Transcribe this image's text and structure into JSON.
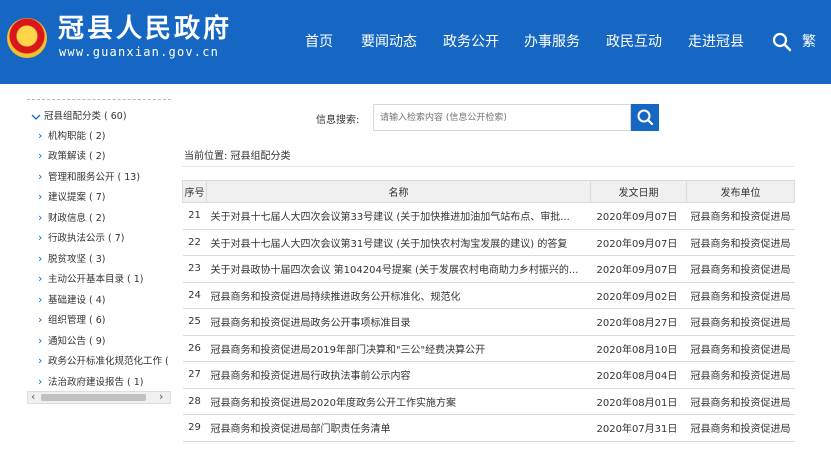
{
  "header": {
    "title": "冠县人民政府",
    "url": "www.guanxian.gov.cn",
    "nav": [
      "首页",
      "要闻动态",
      "政务公开",
      "办事服务",
      "政民互动",
      "走进冠县"
    ],
    "lang_toggle": "繁",
    "search_icon": "search-icon",
    "emblem_icon": "national-emblem-icon",
    "color": "#1567c3"
  },
  "sidebar": {
    "root": "冠县组配分类 ( 60)",
    "items": [
      "机构职能 ( 2)",
      "政策解读 ( 2)",
      "管理和服务公开 ( 13)",
      "建议提案 ( 7)",
      "财政信息 ( 2)",
      "行政执法公示 ( 7)",
      "脱贫攻坚 ( 3)",
      "主动公开基本目录 ( 1)",
      "基础建设 ( 4)",
      "组织管理 ( 6)",
      "通知公告 ( 9)",
      "政务公开标准化规范化工作 (",
      "法治政府建设报告 ( 1)"
    ]
  },
  "search": {
    "label": "信息搜索:",
    "placeholder": "请输入检索内容 (信息公开检索)"
  },
  "breadcrumb": "当前位置: 冠县组配分类",
  "table": {
    "headers": [
      "序号",
      "名称",
      "发文日期",
      "发布单位"
    ],
    "rows": [
      {
        "no": "21",
        "name": "关于对县十七届人大四次会议第33号建议 (关于加快推进加油加气站布点、审批...",
        "date": "2020年09月07日",
        "unit": "冠县商务和投资促进局"
      },
      {
        "no": "22",
        "name": "关于对县十七届人大四次会议第31号建议 (关于加快农村淘宝发展的建议) 的答复",
        "date": "2020年09月07日",
        "unit": "冠县商务和投资促进局"
      },
      {
        "no": "23",
        "name": "关于对县政协十届四次会议 第104204号提案 (关于发展农村电商助力乡村振兴的...",
        "date": "2020年09月07日",
        "unit": "冠县商务和投资促进局"
      },
      {
        "no": "24",
        "name": "冠县商务和投资促进局持续推进政务公开标准化、规范化",
        "date": "2020年09月02日",
        "unit": "冠县商务和投资促进局"
      },
      {
        "no": "25",
        "name": "冠县商务和投资促进局政务公开事项标准目录",
        "date": "2020年08月27日",
        "unit": "冠县商务和投资促进局"
      },
      {
        "no": "26",
        "name": "冠县商务和投资促进局2019年部门决算和\"三公\"经费决算公开",
        "date": "2020年08月10日",
        "unit": "冠县商务和投资促进局"
      },
      {
        "no": "27",
        "name": "冠县商务和投资促进局行政执法事前公示内容",
        "date": "2020年08月04日",
        "unit": "冠县商务和投资促进局"
      },
      {
        "no": "28",
        "name": "冠县商务和投资促进局2020年度政务公开工作实施方案",
        "date": "2020年08月01日",
        "unit": "冠县商务和投资促进局"
      },
      {
        "no": "29",
        "name": "冠县商务和投资促进局部门职责任务清单",
        "date": "2020年07月31日",
        "unit": "冠县商务和投资促进局"
      }
    ]
  }
}
